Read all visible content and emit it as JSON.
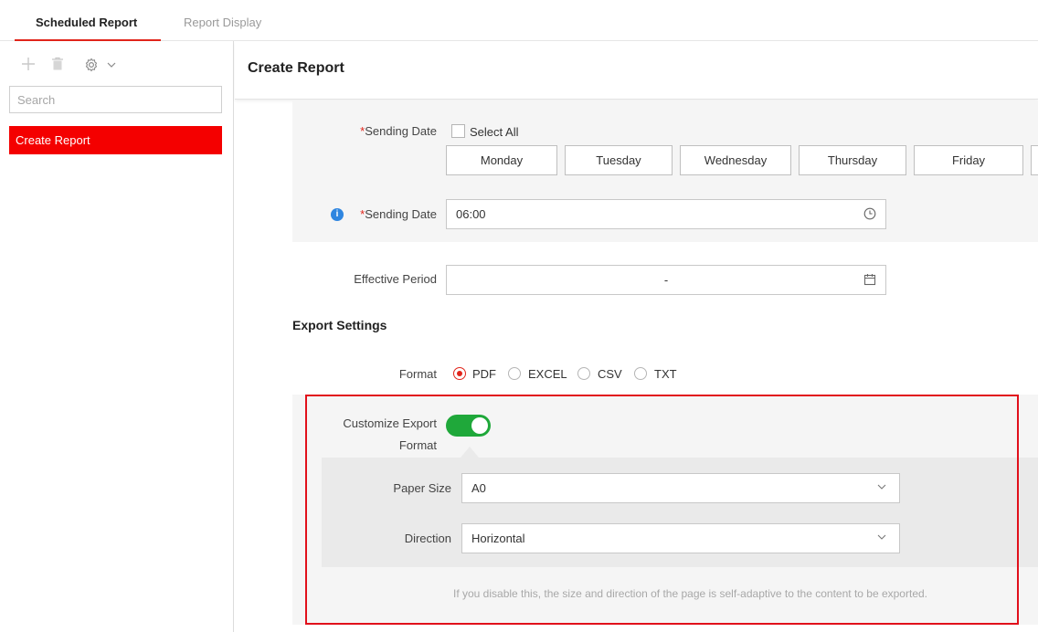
{
  "tabs": [
    {
      "label": "Scheduled Report",
      "active": true
    },
    {
      "label": "Report Display",
      "active": false
    }
  ],
  "toolbar": {
    "add_icon": "plus-icon",
    "delete_icon": "trash-icon",
    "settings_icon": "gear-icon",
    "dropdown_icon": "chevron-down-icon"
  },
  "sidebar": {
    "search_placeholder": "Search",
    "items": [
      {
        "label": "Create Report",
        "selected": true
      }
    ]
  },
  "main": {
    "title": "Create Report",
    "sending_days": {
      "label": "Sending Date",
      "select_all": "Select All",
      "days": [
        "Monday",
        "Tuesday",
        "Wednesday",
        "Thursday",
        "Friday"
      ]
    },
    "sending_time": {
      "label": "Sending Date",
      "value": "06:00"
    },
    "effective_period": {
      "label": "Effective Period",
      "value": "-"
    },
    "export_settings": {
      "title": "Export Settings",
      "format_label": "Format",
      "formats": [
        "PDF",
        "EXCEL",
        "CSV",
        "TXT"
      ],
      "selected_format": "PDF",
      "customize_label_line1": "Customize Export",
      "customize_label_line2": "Format",
      "customize_enabled": true,
      "paper_size_label": "Paper Size",
      "paper_size_value": "A0",
      "direction_label": "Direction",
      "direction_value": "Horizontal",
      "hint": "If you disable this, the size and direction of the page is self-adaptive to the content to be exported."
    }
  },
  "colors": {
    "accent": "#e1251b",
    "selected_item_bg": "#f40000",
    "toggle_on": "#1fa83a",
    "info_icon": "#2f86e0"
  }
}
